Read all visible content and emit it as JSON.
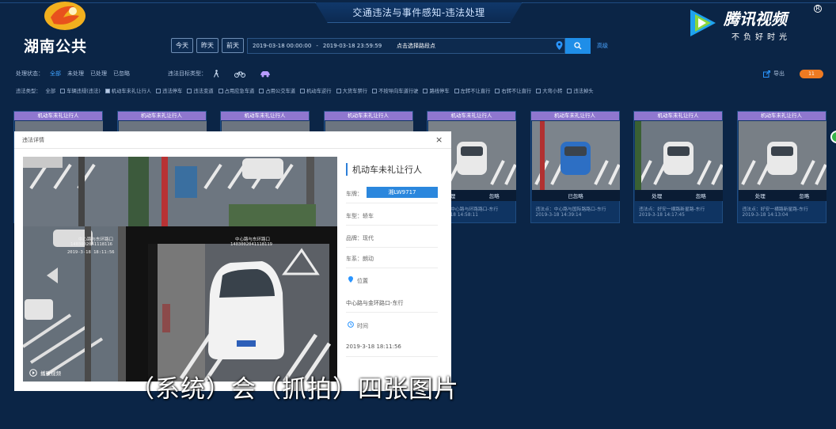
{
  "app": {
    "title": "交通违法与事件感知-违法处理",
    "brand_text": "湖南公共",
    "watermark_name": "腾讯视频",
    "watermark_slogan": "不负好时光"
  },
  "search": {
    "date_buttons": [
      "今天",
      "昨天",
      "前天"
    ],
    "start_time": "2019-03-18 00:00:00",
    "end_time": "2019-03-18 23:59:59",
    "location_placeholder": "点击选择路段点",
    "advanced_label": "高级"
  },
  "filters": {
    "status_label": "处理状态：",
    "status_options": [
      "全部",
      "未处理",
      "已处理",
      "已忽略"
    ],
    "status_active": "全部",
    "object_label": "违法目标类型：",
    "export_label": "导出",
    "toggle_label": "11",
    "type_label": "违法类型：",
    "type_all": "全部",
    "types": [
      {
        "label": "车辆违规(违法)",
        "checked": false
      },
      {
        "label": "机动车未礼让行人",
        "checked": true
      },
      {
        "label": "违法停车",
        "checked": false
      },
      {
        "label": "违法变道",
        "checked": false
      },
      {
        "label": "占用应急车道",
        "checked": false
      },
      {
        "label": "占用公交车道",
        "checked": false
      },
      {
        "label": "机动车逆行",
        "checked": false
      },
      {
        "label": "大货车禁行",
        "checked": false
      },
      {
        "label": "不按导向车道行驶",
        "checked": false
      },
      {
        "label": "路线停车",
        "checked": false
      },
      {
        "label": "左转不让直行",
        "checked": false
      },
      {
        "label": "右转不让直行",
        "checked": false
      },
      {
        "label": "大弯小转",
        "checked": false
      },
      {
        "label": "违法掉头",
        "checked": false
      }
    ]
  },
  "cards": [
    {
      "title": "机动车未礼让行人"
    },
    {
      "title": "机动车未礼让行人"
    },
    {
      "title": "机动车未礼让行人"
    },
    {
      "title": "机动车未礼让行人"
    },
    {
      "title": "机动车未礼让行人",
      "actions": [
        "处理",
        "忽略"
      ],
      "location": "违法点：中心路与环路路口-东行",
      "time": "2019-3-18 14:58:11"
    },
    {
      "title": "机动车未礼让行人",
      "actions": [
        "已忽略"
      ],
      "location": "违法点：中心路与国际路路口-东行",
      "time": "2019-3-18 14:39:14"
    },
    {
      "title": "机动车未礼让行人",
      "actions": [
        "处理",
        "忽略"
      ],
      "location": "违法点：好安一横路新星路-东行",
      "time": "2019-3-18 14:17:45"
    },
    {
      "title": "机动车未礼让行人",
      "actions": [
        "处理",
        "忽略"
      ],
      "location": "违法点：好安一横路新星路-东行",
      "time": "2019-3-18 14:13:04"
    }
  ],
  "modal": {
    "title": "违法详情",
    "close": "×",
    "violation": "机动车未礼让行人",
    "plate_label": "车牌：",
    "plate": "湘LW9717",
    "type_label": "车型：",
    "type_value": "轿车",
    "brand_label": "品牌：",
    "brand_value": "现代",
    "series_label": "车系：",
    "series_value": "朗动",
    "location_label": "位置",
    "location_value": "中心路与金环路口-东行",
    "time_label": "时间",
    "time_value": "2019-3-18 18:11:56",
    "play_label": "播放视频",
    "watermarks": [
      "中心路与东环路口",
      "1403002041118116",
      "中心路与东环路口",
      "1403002041118119",
      "2019-3-18 18:11:56"
    ]
  },
  "subtitle": "（系统）会（抓拍）四张图片"
}
